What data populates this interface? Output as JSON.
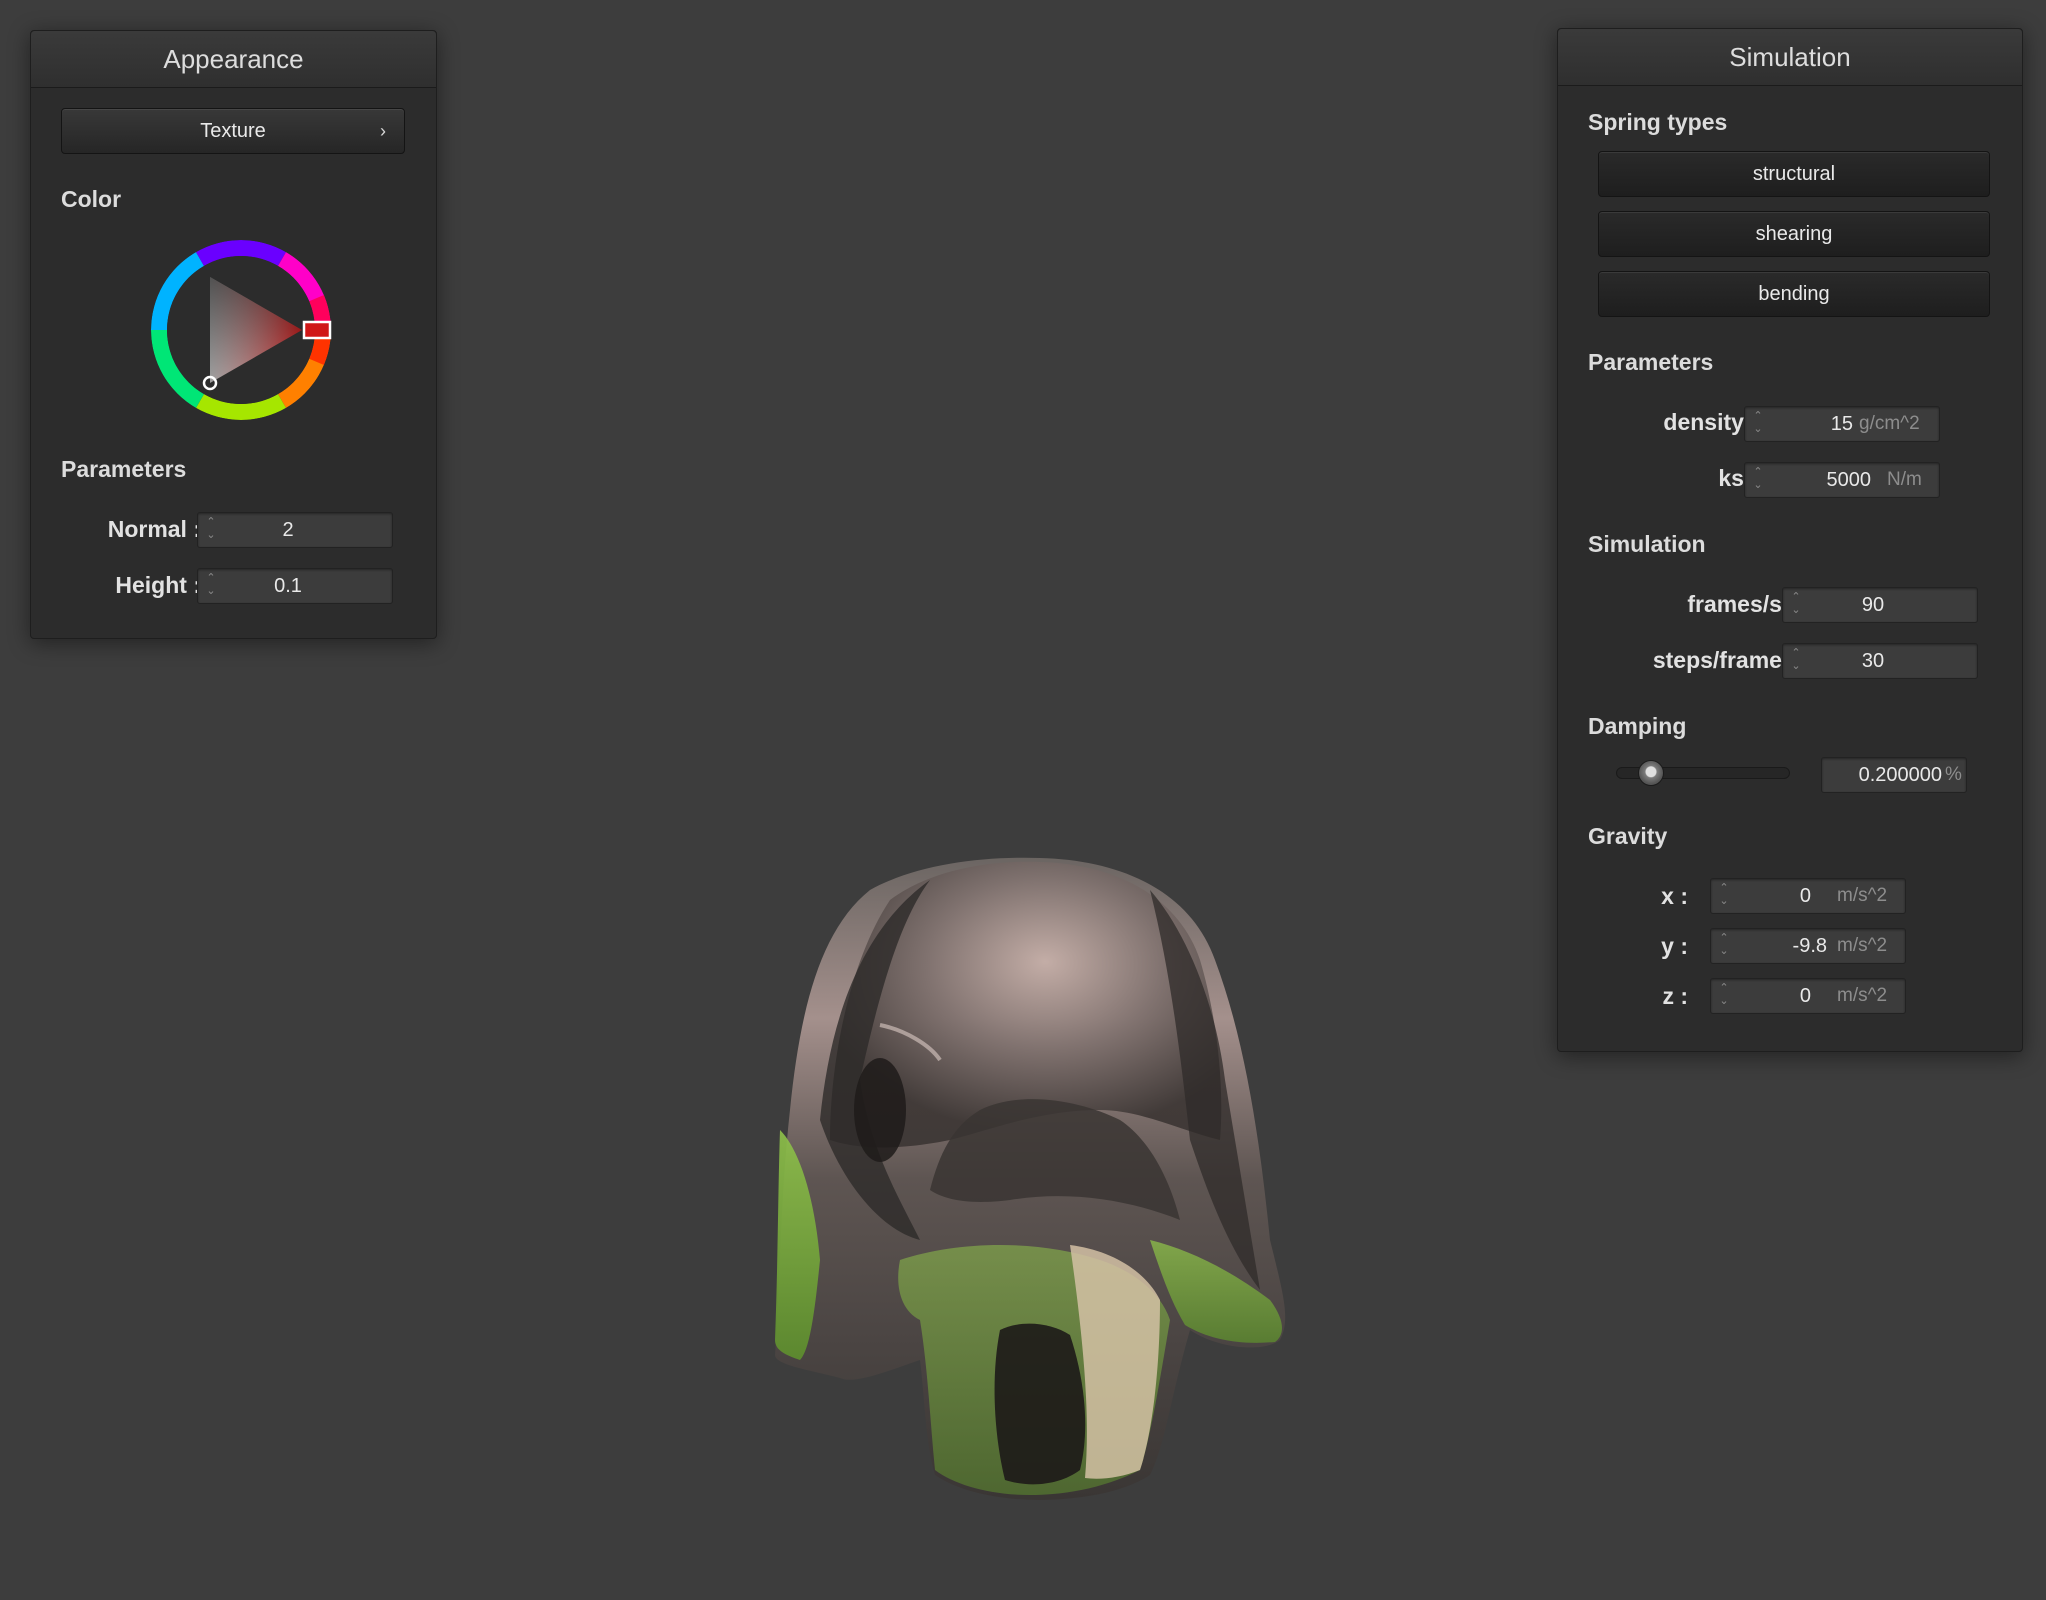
{
  "appearance": {
    "title": "Appearance",
    "texture_button": "Texture",
    "texture_chevron": "›",
    "color_label": "Color",
    "color_value": "#cc1f1f",
    "parameters_label": "Parameters",
    "normal": {
      "label": "Normal :",
      "value": "2"
    },
    "height": {
      "label": "Height :",
      "value": "0.1"
    }
  },
  "simulation": {
    "title": "Simulation",
    "spring_types_label": "Spring types",
    "spring_buttons": [
      "structural",
      "shearing",
      "bending"
    ],
    "parameters_label": "Parameters",
    "density": {
      "label": "density :",
      "value": "15",
      "unit": "g/cm^2"
    },
    "ks": {
      "label": "ks :",
      "value": "5000",
      "unit": "N/m"
    },
    "simulation_label": "Simulation",
    "fps": {
      "label": "frames/s :",
      "value": "90"
    },
    "steps": {
      "label": "steps/frame :",
      "value": "30"
    },
    "damping_label": "Damping",
    "damping": {
      "value": "0.200000",
      "unit": "%",
      "slider_fraction": 0.2
    },
    "gravity_label": "Gravity",
    "gx": {
      "label": "x :",
      "value": "0",
      "unit": "m/s^2"
    },
    "gy": {
      "label": "y :",
      "value": "-9.8",
      "unit": "m/s^2"
    },
    "gz": {
      "label": "z :",
      "value": "0",
      "unit": "m/s^2"
    }
  },
  "icons": {
    "spinner": "spin-arrows-icon",
    "chevron": "chevron-right-icon",
    "color_wheel": "color-wheel-icon"
  }
}
